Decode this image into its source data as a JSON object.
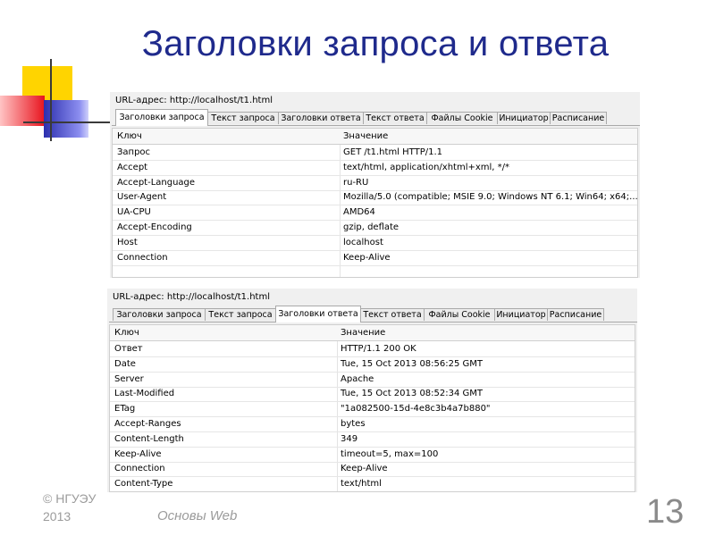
{
  "slide": {
    "title": "Заголовки запроса и ответа",
    "page_number": "13",
    "copyright": "© НГУЭУ",
    "year": "2013",
    "course": "Основы Web",
    "decoration_colors": {
      "yellow": "#ffd400",
      "red": "#e8141e",
      "blue": "#2c2fae",
      "line": "#3a3a3a"
    }
  },
  "request_panel": {
    "url_label": "URL-адрес: http://localhost/t1.html",
    "tabs": [
      "Заголовки запроса",
      "Текст запроса",
      "Заголовки ответа",
      "Текст ответа",
      "Файлы Cookie",
      "Инициатор",
      "Расписание"
    ],
    "active_tab": 0,
    "columns": [
      "Ключ",
      "Значение"
    ],
    "rows": [
      [
        "Запрос",
        "GET /t1.html HTTP/1.1"
      ],
      [
        "Accept",
        "text/html, application/xhtml+xml, */*"
      ],
      [
        "Accept-Language",
        "ru-RU"
      ],
      [
        "User-Agent",
        "Mozilla/5.0 (compatible; MSIE 9.0; Windows NT 6.1; Win64; x64;..."
      ],
      [
        "UA-CPU",
        "AMD64"
      ],
      [
        "Accept-Encoding",
        "gzip, deflate"
      ],
      [
        "Host",
        "localhost"
      ],
      [
        "Connection",
        "Keep-Alive"
      ]
    ]
  },
  "response_panel": {
    "url_label": "URL-адрес: http://localhost/t1.html",
    "tabs": [
      "Заголовки запроса",
      "Текст запроса",
      "Заголовки ответа",
      "Текст ответа",
      "Файлы Cookie",
      "Инициатор",
      "Расписание"
    ],
    "active_tab": 2,
    "columns": [
      "Ключ",
      "Значение"
    ],
    "rows": [
      [
        "Ответ",
        "HTTP/1.1 200 OK"
      ],
      [
        "Date",
        "Tue, 15 Oct 2013 08:56:25 GMT"
      ],
      [
        "Server",
        "Apache"
      ],
      [
        "Last-Modified",
        "Tue, 15 Oct 2013 08:52:34 GMT"
      ],
      [
        "ETag",
        "\"1a082500-15d-4e8c3b4a7b880\""
      ],
      [
        "Accept-Ranges",
        "bytes"
      ],
      [
        "Content-Length",
        "349"
      ],
      [
        "Keep-Alive",
        "timeout=5, max=100"
      ],
      [
        "Connection",
        "Keep-Alive"
      ],
      [
        "Content-Type",
        "text/html"
      ]
    ]
  }
}
